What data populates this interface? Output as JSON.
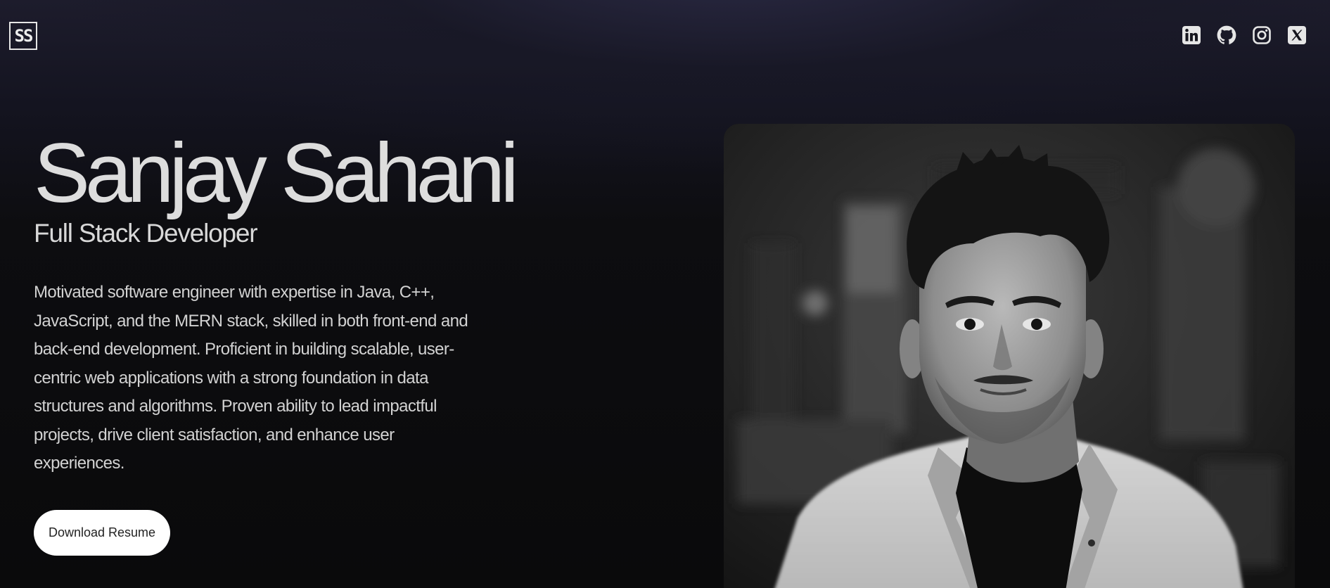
{
  "logo": {
    "text": "SS",
    "icon": "ss-monogram-logo"
  },
  "socials": [
    {
      "name": "linkedin",
      "icon": "linkedin-icon"
    },
    {
      "name": "github",
      "icon": "github-icon"
    },
    {
      "name": "instagram",
      "icon": "instagram-icon"
    },
    {
      "name": "x",
      "icon": "x-icon"
    }
  ],
  "hero": {
    "name": "Sanjay Sahani",
    "role": "Full Stack Developer",
    "bio": "Motivated software engineer with expertise in Java, C++, JavaScript, and the MERN stack, skilled in both front-end and back-end development. Proficient in building scalable, user-centric web applications with a strong foundation in data structures and algorithms. Proven ability to lead impactful projects, drive client satisfaction, and enhance user experiences.",
    "button_label": "Download Resume"
  },
  "colors": {
    "background": "#0b0b0c",
    "header_glow": "#2d2c48",
    "text": "#dddddd",
    "button_bg": "#ffffff",
    "button_text": "#222222"
  }
}
